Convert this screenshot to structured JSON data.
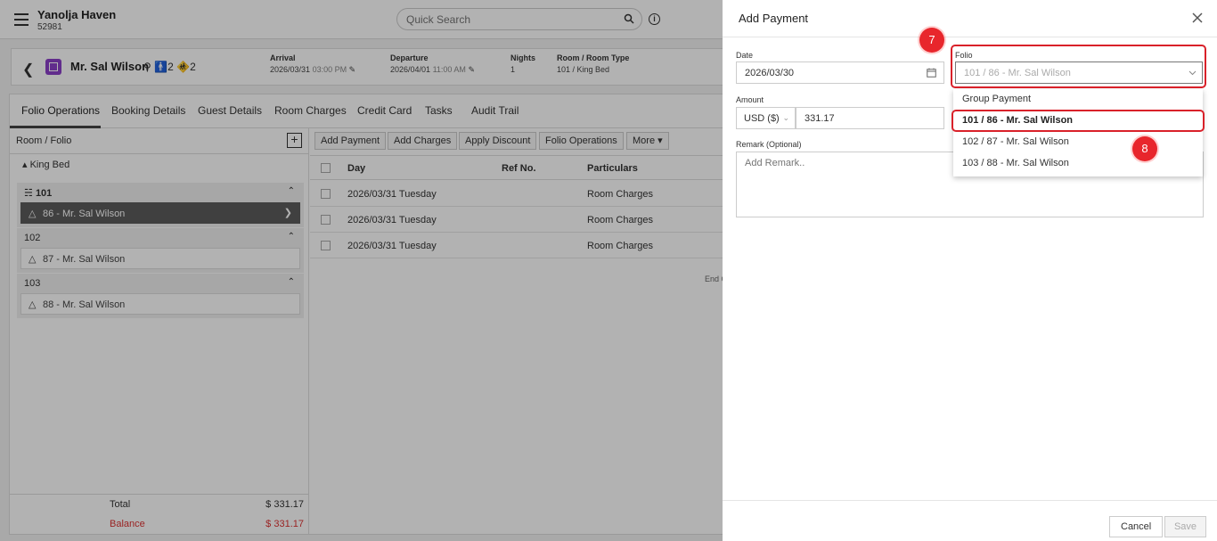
{
  "header": {
    "hotel_name": "Yanolja Haven",
    "hotel_id": "52981",
    "search_placeholder": "Quick Search"
  },
  "guest": {
    "name": "Mr. Sal Wilson",
    "adults": "2",
    "children": "2",
    "arrival_label": "Arrival",
    "arrival_date": "2026/03/31",
    "arrival_time": "03:00 PM",
    "departure_label": "Departure",
    "departure_date": "2026/04/01",
    "departure_time": "11:00 AM",
    "nights_label": "Nights",
    "nights": "1",
    "room_label": "Room / Room Type",
    "room_value": "101 / King Bed"
  },
  "tabs": [
    "Folio Operations",
    "Booking Details",
    "Guest Details",
    "Room Charges",
    "Credit Card",
    "Tasks",
    "Audit Trail"
  ],
  "left_panel": {
    "title": "Room / Folio",
    "room_type": "King Bed",
    "rooms": [
      {
        "number": "101",
        "folio": "86 - Mr. Sal Wilson"
      },
      {
        "number": "102",
        "folio": "87 - Mr. Sal Wilson"
      },
      {
        "number": "103",
        "folio": "88 - Mr. Sal Wilson"
      }
    ],
    "total_label": "Total",
    "total_value": "$ 331.17",
    "balance_label": "Balance",
    "balance_value": "$ 331.17"
  },
  "toolbar": [
    "Add Payment",
    "Add Charges",
    "Apply Discount",
    "Folio Operations",
    "More"
  ],
  "grid": {
    "columns": [
      "Day",
      "Ref No.",
      "Particulars"
    ],
    "rows": [
      {
        "day": "2026/03/31 Tuesday",
        "ref": "",
        "particulars": "Room Charges"
      },
      {
        "day": "2026/03/31 Tuesday",
        "ref": "",
        "particulars": "Room Charges"
      },
      {
        "day": "2026/03/31 Tuesday",
        "ref": "",
        "particulars": "Room Charges"
      }
    ],
    "end_text": "End O"
  },
  "drawer": {
    "title": "Add Payment",
    "date_label": "Date",
    "date_value": "2026/03/30",
    "folio_label": "Folio",
    "folio_value": "101 / 86 - Mr. Sal Wilson",
    "amount_label": "Amount",
    "currency": "USD ($)",
    "amount_value": "331.17",
    "remark_label": "Remark (Optional)",
    "remark_placeholder": "Add Remark..",
    "folio_options": [
      "Group Payment",
      "101 / 86 - Mr. Sal Wilson",
      "102 / 87 - Mr. Sal Wilson",
      "103 / 88 - Mr. Sal Wilson"
    ],
    "cancel_label": "Cancel",
    "save_label": "Save"
  },
  "annotations": {
    "step7": "7",
    "step8": "8",
    "color": "#e8262c"
  }
}
